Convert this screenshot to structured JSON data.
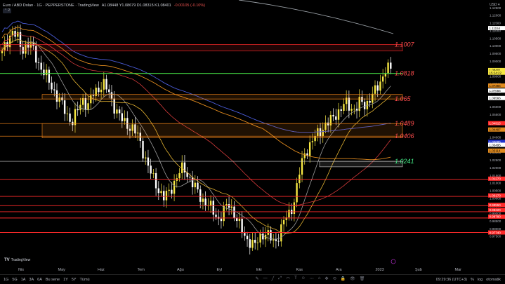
{
  "header": {
    "symbol": "Euro / ABD Doları · 1G · PEPPERSTONE · TradingView",
    "ohlc": "A1.08448 Y1.08679 D1.08315 K1.08401",
    "change": "-0.00105 (-0.10%)",
    "collapse": "⌃ 2"
  },
  "logo": {
    "mark": "TV",
    "text": "TradingView"
  },
  "bottom_bar": {
    "ranges": [
      "1G",
      "5G",
      "1A",
      "3A",
      "6A",
      "Bu sene",
      "1Y",
      "5Y",
      "Tümü"
    ],
    "tools": [
      "✎",
      "—",
      "╱",
      "⤢",
      "⌒",
      "T",
      "☺",
      "⋯",
      "⌂",
      "✥",
      "⟲",
      "🔒",
      "👁",
      "🗑"
    ],
    "time": "09:29:36 (UTC+3)",
    "percent": "%",
    "log": "log",
    "auto": "otomatik"
  },
  "colors": {
    "up": "#f5e642",
    "down": "#ffffff",
    "bg": "#000000",
    "level_red": "#ff2a2a",
    "level_orange": "#ff8c1a",
    "level_green": "#44dd44",
    "ma200": "#4a5bd6",
    "ma_orange": "#e08a1e",
    "ma_red": "#d23a3a",
    "ma_grey": "#9b9b9b"
  },
  "chart_data": {
    "type": "candlestick",
    "symbol": "EURUSD",
    "timeframe": "1G",
    "x_labels": [
      "Nis",
      "May",
      "Haz",
      "Tem",
      "Ağu",
      "Eyl",
      "Eki",
      "Kas",
      "Ara",
      "2023",
      "Şub",
      "Mar"
    ],
    "y_ticks": [
      1.125,
      1.12,
      1.115,
      1.11,
      1.105,
      1.1,
      1.095,
      1.09,
      1.085,
      1.08,
      1.075,
      1.07,
      1.065,
      1.06,
      1.055,
      1.05,
      1.045,
      1.04,
      1.035,
      1.03,
      1.025,
      1.02,
      1.015,
      1.01,
      1.005,
      1.0,
      0.995,
      0.99,
      0.985,
      0.98,
      0.975
    ],
    "ylim": [
      0.956,
      1.13
    ],
    "last_price": 1.08401,
    "countdown": "15:24:22",
    "levels": [
      {
        "label": "1.1007",
        "price": 1.1007,
        "color": "#ff2a2a",
        "zone_low": 1.0965,
        "zone_high": 1.1007
      },
      {
        "label": "1.0818",
        "price": 1.0818,
        "color": "#44dd44"
      },
      {
        "label": "1.065",
        "price": 1.065,
        "color": "#ff8c1a",
        "zone_low": 1.065,
        "zone_high": 1.068
      },
      {
        "label": "1.0489",
        "price": 1.0489,
        "color": "#ff8c1a"
      },
      {
        "label": "1.0406",
        "price": 1.0406,
        "color": "#ff8c1a",
        "zone_low": 1.0395,
        "zone_high": 1.0489
      },
      {
        "label": "1.0241",
        "price": 1.0241,
        "color": "#d0d0d0",
        "zone_low": 1.0205,
        "zone_high": 1.0241
      }
    ],
    "red_lines": [
      1.0123,
      1.0011,
      0.995,
      0.991,
      0.9869,
      0.9774
    ],
    "scale_tags": [
      {
        "price": 1.08401,
        "text": "1.08401",
        "bg": "#f5e642",
        "fg": "#000"
      },
      {
        "price": 1.08226,
        "text": "15:24:22",
        "bg": "#f5e642",
        "fg": "#000"
      },
      {
        "price": 1.07384,
        "text": "1.07384",
        "bg": "#e08a1e",
        "fg": "#000"
      },
      {
        "price": 1.07056,
        "text": "1.07056",
        "bg": "#ffffff",
        "fg": "#000"
      },
      {
        "price": 1.06566,
        "text": "1.06566",
        "bg": "#ffffff",
        "fg": "#000"
      },
      {
        "price": 1.04915,
        "text": "1.04915",
        "bg": "#ff2a2a",
        "fg": "#fff"
      },
      {
        "price": 1.04497,
        "text": "1.04497",
        "bg": "#e08a1e",
        "fg": "#000"
      },
      {
        "price": 1.03685,
        "text": "1.03685",
        "bg": "#2233cc",
        "fg": "#fff"
      },
      {
        "price": 1.03495,
        "text": "1.03495",
        "bg": "#ffffff",
        "fg": "#000"
      },
      {
        "price": 1.03114,
        "text": "1.03114",
        "bg": "#e08a1e",
        "fg": "#000"
      },
      {
        "price": 1.0127,
        "text": "1.01270",
        "bg": "#ff2a2a",
        "fg": "#fff"
      },
      {
        "price": 1.0017,
        "text": "1.00170",
        "bg": "#ff2a2a",
        "fg": "#fff"
      },
      {
        "price": 0.9955,
        "text": "0.99550",
        "bg": "#ff2a2a",
        "fg": "#fff"
      },
      {
        "price": 0.9922,
        "text": "0.99220",
        "bg": "#ff2a2a",
        "fg": "#fff"
      },
      {
        "price": 0.9878,
        "text": "0.98780",
        "bg": "#ff2a2a",
        "fg": "#fff"
      },
      {
        "price": 0.9774,
        "text": "0.97740",
        "bg": "#ff2a2a",
        "fg": "#fff"
      },
      {
        "price": 1.11154,
        "text": "1.11154",
        "bg": "#ffffff",
        "fg": "#000"
      }
    ],
    "price_path": [
      1.095,
      1.103,
      1.11,
      1.105,
      1.097,
      1.102,
      1.098,
      1.09,
      1.084,
      1.078,
      1.072,
      1.066,
      1.06,
      1.054,
      1.05,
      1.058,
      1.065,
      1.06,
      1.068,
      1.072,
      1.075,
      1.07,
      1.062,
      1.055,
      1.05,
      1.048,
      1.045,
      1.04,
      1.03,
      1.02,
      1.012,
      1.006,
      1.0,
      1.003,
      1.01,
      1.016,
      1.02,
      1.014,
      1.008,
      1.002,
      0.998,
      0.995,
      0.99,
      0.986,
      0.992,
      0.996,
      0.99,
      0.982,
      0.975,
      0.972,
      0.968,
      0.974,
      0.978,
      0.974,
      0.97,
      0.978,
      0.986,
      0.99,
      1.0,
      1.018,
      1.03,
      1.035,
      1.04,
      1.044,
      1.048,
      1.05,
      1.055,
      1.058,
      1.062,
      1.06,
      1.058,
      1.063,
      1.061,
      1.066,
      1.07,
      1.077,
      1.085,
      1.084
    ]
  }
}
